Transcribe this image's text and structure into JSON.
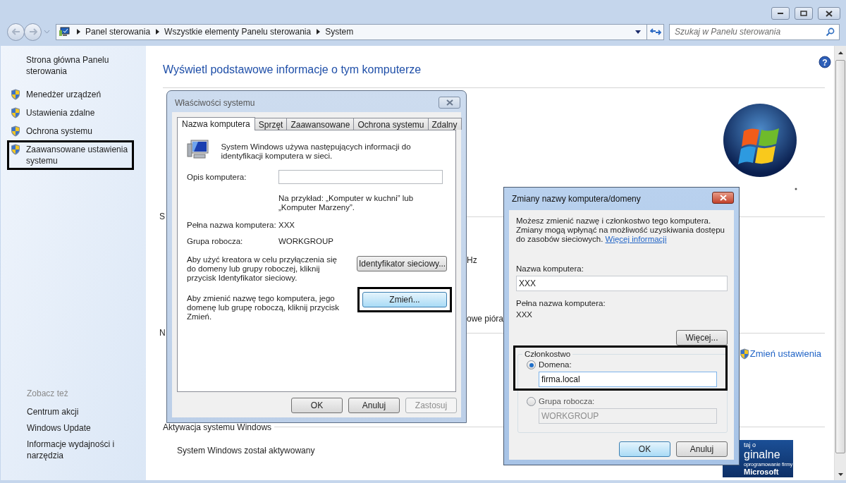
{
  "window": {
    "breadcrumb": [
      "Panel sterowania",
      "Wszystkie elementy Panelu sterowania",
      "System"
    ],
    "search": {
      "placeholder": "Szukaj w Panelu sterowania"
    }
  },
  "sidebar": {
    "home": "Strona główna Panelu sterowania",
    "tasks": [
      {
        "label": "Menedżer urządzeń",
        "highlighted": false
      },
      {
        "label": "Ustawienia zdalne",
        "highlighted": false
      },
      {
        "label": "Ochrona systemu",
        "highlighted": false
      },
      {
        "label": "Zaawansowane ustawienia systemu",
        "highlighted": true
      }
    ],
    "see_also_title": "Zobacz też",
    "see_also": [
      "Centrum akcji",
      "Windows Update",
      "Informacje wydajności i narzędzia"
    ]
  },
  "main": {
    "help": "?",
    "heading": "Wyświetl podstawowe informacje o tym komputerze",
    "section_fragment_1": "S",
    "fragment_hz": "Hz",
    "fragment_pen": "owe pióra",
    "section_fragment_2": "N",
    "change_settings": "Zmień ustawienia",
    "activation_title": "Aktywacja systemu Windows",
    "activation_status": "System Windows został aktywowany",
    "genuine_badge": [
      "taj o",
      "ginalne",
      "oprogramowanie firmy",
      "Microsoft"
    ]
  },
  "system_properties": {
    "title": "Właściwości systemu",
    "tabs": [
      {
        "label": "Nazwa komputera",
        "selected": true
      },
      {
        "label": "Sprzęt",
        "selected": false
      },
      {
        "label": "Zaawansowane",
        "selected": false
      },
      {
        "label": "Ochrona systemu",
        "selected": false
      },
      {
        "label": "Zdalny",
        "selected": false
      }
    ],
    "intro": "System Windows używa następujących informacji do identyfikacji komputera w sieci.",
    "description_label": "Opis komputera:",
    "description_hint": "Na przykład: „Komputer w kuchni” lub „Komputer Marzeny”.",
    "full_name_label": "Pełna nazwa komputera:",
    "full_name": "XXX",
    "workgroup_label": "Grupa robocza:",
    "workgroup": "WORKGROUP",
    "network_id_text": "Aby użyć kreatora w celu przyłączenia się do domeny lub grupy roboczej, kliknij przycisk Identyfikator sieciowy.",
    "network_id_button": "Identyfikator sieciowy...",
    "change_text": "Aby zmienić nazwę tego komputera, jego domenę lub grupę roboczą, kliknij przycisk Zmień.",
    "change_button": {
      "label": "Zmień...",
      "highlighted": true
    },
    "buttons": [
      {
        "label": "OK",
        "disabled": false
      },
      {
        "label": "Anuluj",
        "disabled": false
      },
      {
        "label": "Zastosuj",
        "disabled": true
      }
    ]
  },
  "rename_dialog": {
    "title": "Zmiany nazwy komputera/domeny",
    "intro": "Możesz zmienić nazwę i członkostwo tego komputera. Zmiany mogą wpłynąć na możliwość uzyskiwania dostępu do zasobów sieciowych.",
    "more_info_link": "Więcej informacji",
    "name_label": "Nazwa komputera:",
    "name_value": "XXX",
    "full_name_label": "Pełna nazwa komputera:",
    "full_name": "XXX",
    "more_button": "Więcej...",
    "membership": {
      "title": "Członkostwo",
      "highlighted": true,
      "options": [
        {
          "label": "Domena:",
          "selected": true,
          "value": "firma.local"
        },
        {
          "label": "Grupa robocza:",
          "selected": false,
          "value": "WORKGROUP"
        }
      ]
    },
    "buttons": [
      {
        "label": "OK",
        "default": true
      },
      {
        "label": "Anuluj",
        "default": false
      }
    ]
  }
}
